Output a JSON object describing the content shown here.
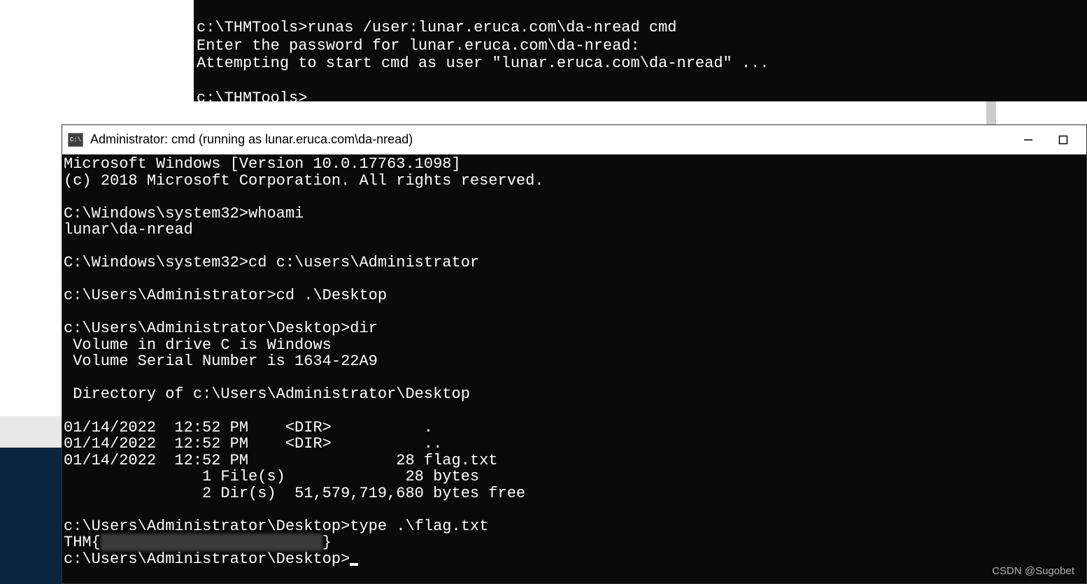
{
  "terminal_top": {
    "lines": [
      "",
      "c:\\THMTools>runas /user:lunar.eruca.com\\da-nread cmd",
      "Enter the password for lunar.eruca.com\\da-nread:",
      "Attempting to start cmd as user \"lunar.eruca.com\\da-nread\" ...",
      "",
      "c:\\THMTools>"
    ]
  },
  "window": {
    "title": "Administrator: cmd (running as lunar.eruca.com\\da-nread)",
    "icon_label": "C:\\"
  },
  "terminal_main": {
    "lines": [
      "Microsoft Windows [Version 10.0.17763.1098]",
      "(c) 2018 Microsoft Corporation. All rights reserved.",
      "",
      "C:\\Windows\\system32>whoami",
      "lunar\\da-nread",
      "",
      "C:\\Windows\\system32>cd c:\\users\\Administrator",
      "",
      "c:\\Users\\Administrator>cd .\\Desktop",
      "",
      "c:\\Users\\Administrator\\Desktop>dir",
      " Volume in drive C is Windows",
      " Volume Serial Number is 1634-22A9",
      "",
      " Directory of c:\\Users\\Administrator\\Desktop",
      "",
      "01/14/2022  12:52 PM    <DIR>          .",
      "01/14/2022  12:52 PM    <DIR>          ..",
      "01/14/2022  12:52 PM                28 flag.txt",
      "               1 File(s)             28 bytes",
      "               2 Dir(s)  51,579,719,680 bytes free",
      "",
      "c:\\Users\\Administrator\\Desktop>type .\\flag.txt"
    ],
    "flag_prefix": "THM{",
    "flag_redacted": "XXXXXXXXXXXXXXXXXXXXXXXX",
    "flag_suffix": "}",
    "final_prompt": "c:\\Users\\Administrator\\Desktop>"
  },
  "watermark": "CSDN @Sugobet"
}
